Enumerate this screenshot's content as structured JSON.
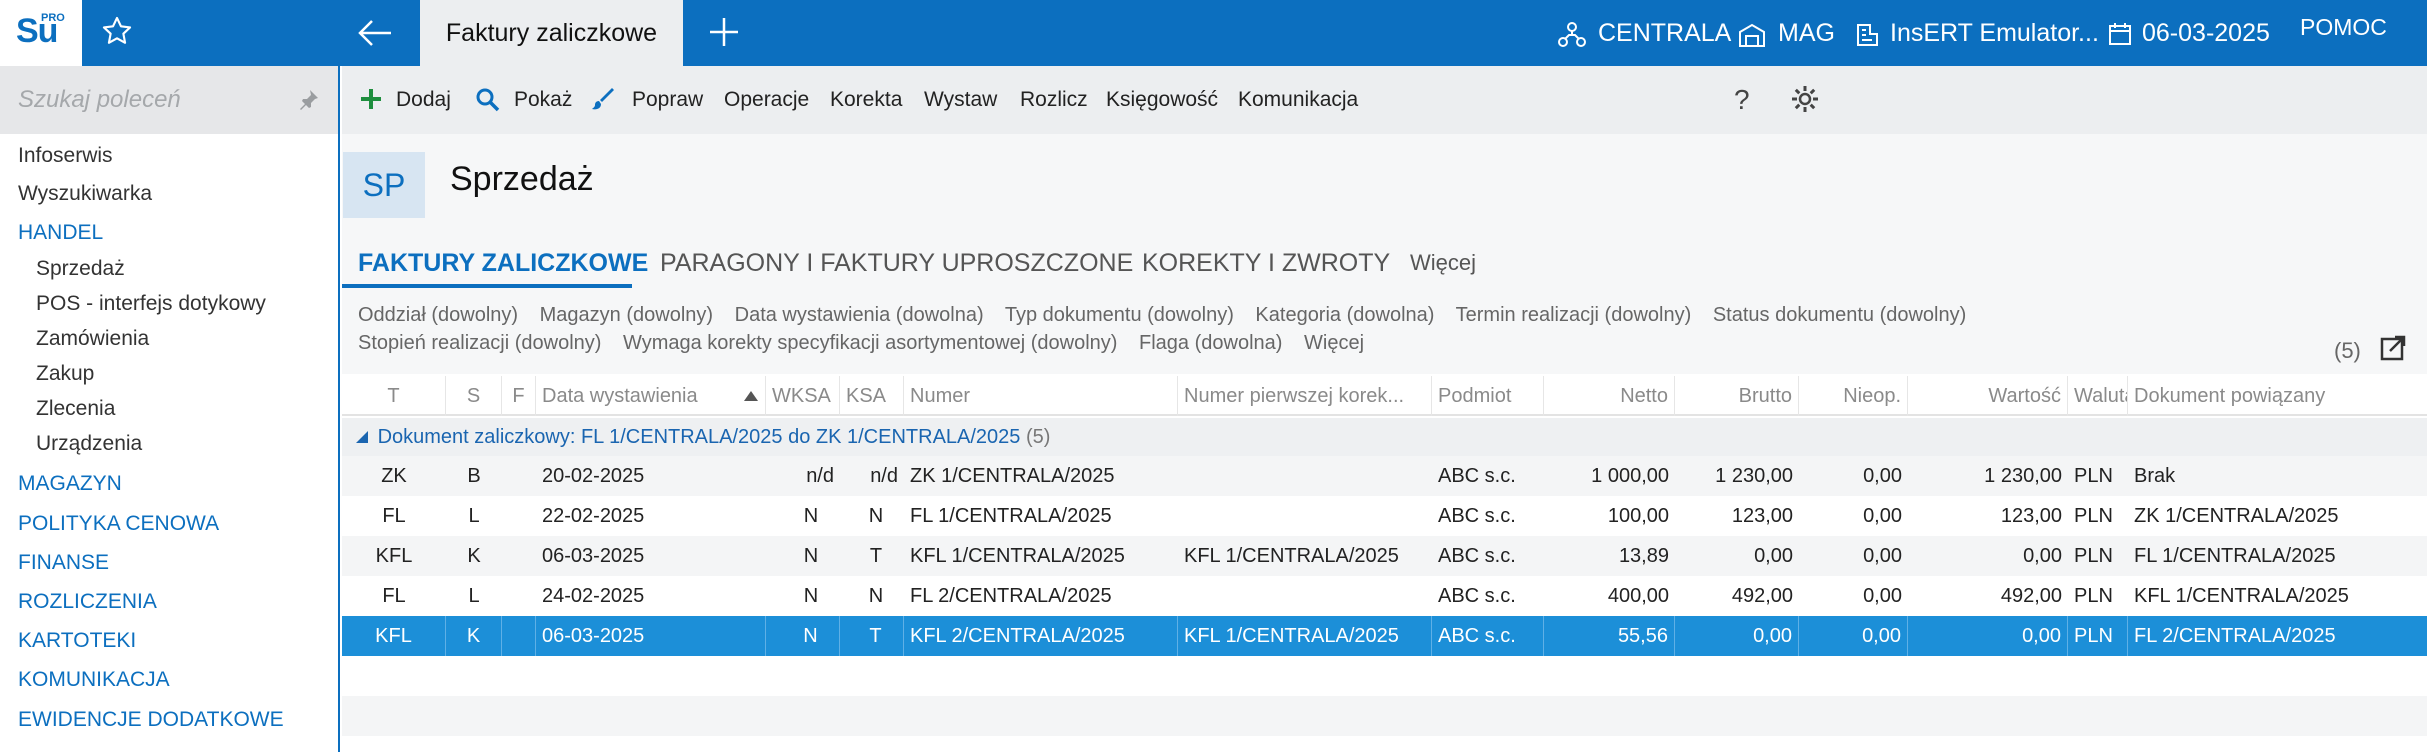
{
  "app": {
    "logo_text": "Su",
    "logo_sup": "PRO",
    "active_tab": "Faktury zaliczkowe",
    "top_items": {
      "branch": "CENTRALA",
      "warehouse": "MAG",
      "user": "InsERT Emulator...",
      "date": "06-03-2025",
      "help": "POMOC"
    },
    "brand_color": "#0c6fbf"
  },
  "sidebar": {
    "search_placeholder": "Szukaj poleceń",
    "items": [
      {
        "label": "Infoserwis"
      },
      {
        "label": "Wyszukiwarka"
      },
      {
        "label": "HANDEL"
      },
      {
        "label": "Sprzedaż"
      },
      {
        "label": "POS - interfejs dotykowy"
      },
      {
        "label": "Zamówienia"
      },
      {
        "label": "Zakup"
      },
      {
        "label": "Zlecenia"
      },
      {
        "label": "Urządzenia"
      },
      {
        "label": "MAGAZYN"
      },
      {
        "label": "POLITYKA CENOWA"
      },
      {
        "label": "FINANSE"
      },
      {
        "label": "ROZLICZENIA"
      },
      {
        "label": "KARTOTEKI"
      },
      {
        "label": "KOMUNIKACJA"
      },
      {
        "label": "EWIDENCJE DODATKOWE"
      }
    ]
  },
  "toolbar": {
    "add": "Dodaj",
    "show": "Pokaż",
    "edit": "Popraw",
    "operations": "Operacje",
    "correction": "Korekta",
    "issue": "Wystaw",
    "settle": "Rozlicz",
    "accounting": "Księgowość",
    "communication": "Komunikacja",
    "help": "?"
  },
  "module": {
    "badge": "SP",
    "title": "Sprzedaż",
    "tabs": [
      {
        "label": "FAKTURY ZALICZKOWE"
      },
      {
        "label": "PARAGONY I FAKTURY UPROSZCZONE"
      },
      {
        "label": "KOREKTY I ZWROTY"
      },
      {
        "label": "Więcej"
      }
    ],
    "filters_row1": [
      "Oddział (dowolny)",
      "Magazyn (dowolny)",
      "Data wystawienia (dowolna)",
      "Typ dokumentu (dowolny)",
      "Kategoria (dowolna)",
      "Termin realizacji (dowolny)",
      "Status dokumentu (dowolny)"
    ],
    "filters_row2": [
      "Stopień realizacji (dowolny)",
      "Wymaga korekty specyfikacji asortymentowej (dowolny)",
      "Flaga (dowolna)",
      "Więcej"
    ],
    "count": "(5)"
  },
  "grid": {
    "columns": [
      "T",
      "S",
      "F",
      "Data wystawienia",
      "WKSA",
      "KSA",
      "Numer",
      "Numer pierwszej korek...",
      "Podmiot",
      "Netto",
      "Brutto",
      "Nieop.",
      "Wartość",
      "Waluta",
      "Dokument powiązany"
    ],
    "group_label": "Dokument zaliczkowy: FL 1/CENTRALA/2025 do ZK 1/CENTRALA/2025",
    "group_count": "(5)",
    "rows": [
      {
        "t": "ZK",
        "s": "B",
        "f": "",
        "date": "20-02-2025",
        "wksa": "n/d",
        "ksa": "n/d",
        "num": "ZK 1/CENTRALA/2025",
        "first_corr": "",
        "party": "ABC s.c.",
        "net": "1 000,00",
        "gross": "1 230,00",
        "unpaid": "0,00",
        "value": "1 230,00",
        "cur": "PLN",
        "related": "Brak"
      },
      {
        "t": "FL",
        "s": "L",
        "f": "",
        "date": "22-02-2025",
        "wksa": "N",
        "ksa": "N",
        "num": "FL 1/CENTRALA/2025",
        "first_corr": "",
        "party": "ABC s.c.",
        "net": "100,00",
        "gross": "123,00",
        "unpaid": "0,00",
        "value": "123,00",
        "cur": "PLN",
        "related": "ZK 1/CENTRALA/2025"
      },
      {
        "t": "KFL",
        "s": "K",
        "f": "",
        "date": "06-03-2025",
        "wksa": "N",
        "ksa": "T",
        "num": "KFL 1/CENTRALA/2025",
        "first_corr": "KFL 1/CENTRALA/2025",
        "party": "ABC s.c.",
        "net": "13,89",
        "gross": "0,00",
        "unpaid": "0,00",
        "value": "0,00",
        "cur": "PLN",
        "related": "FL 1/CENTRALA/2025"
      },
      {
        "t": "FL",
        "s": "L",
        "f": "",
        "date": "24-02-2025",
        "wksa": "N",
        "ksa": "N",
        "num": "FL 2/CENTRALA/2025",
        "first_corr": "",
        "party": "ABC s.c.",
        "net": "400,00",
        "gross": "492,00",
        "unpaid": "0,00",
        "value": "492,00",
        "cur": "PLN",
        "related": "KFL 1/CENTRALA/2025"
      },
      {
        "t": "KFL",
        "s": "K",
        "f": "",
        "date": "06-03-2025",
        "wksa": "N",
        "ksa": "T",
        "num": "KFL 2/CENTRALA/2025",
        "first_corr": "KFL 1/CENTRALA/2025",
        "party": "ABC s.c.",
        "net": "55,56",
        "gross": "0,00",
        "unpaid": "0,00",
        "value": "0,00",
        "cur": "PLN",
        "related": "FL 2/CENTRALA/2025"
      }
    ]
  }
}
